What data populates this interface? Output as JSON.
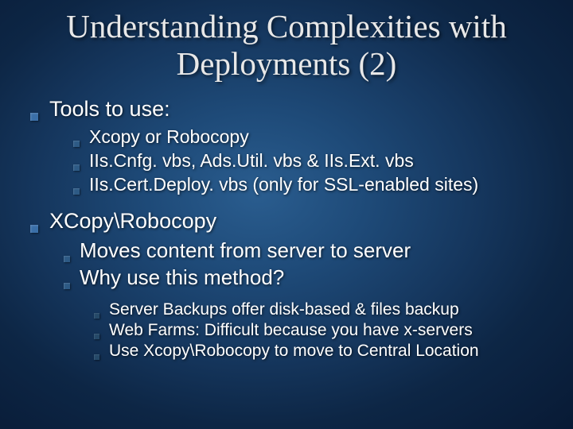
{
  "title": "Understanding Complexities with Deployments (2)",
  "sections": [
    {
      "heading": "Tools to use:",
      "items": [
        "Xcopy or Robocopy",
        "IIs.Cnfg. vbs, Ads.Util. vbs & IIs.Ext. vbs",
        "IIs.Cert.Deploy. vbs (only for SSL-enabled sites)"
      ]
    },
    {
      "heading": "XCopy\\Robocopy",
      "subitems": [
        "Moves content from server to server",
        "Why use this method?"
      ],
      "subsubitems": [
        "Server Backups offer disk-based & files backup",
        " Web Farms:  Difficult because you have x-servers",
        " Use Xcopy\\Robocopy to move to Central Location"
      ]
    }
  ]
}
